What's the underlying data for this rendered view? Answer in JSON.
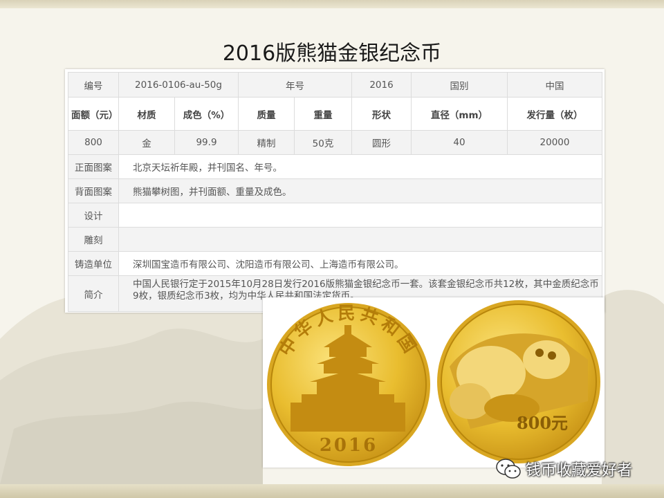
{
  "title": "2016版熊猫金银纪念币",
  "table": {
    "row1": {
      "serial_label": "编号",
      "serial_value": "2016-0106-au-50g",
      "year_label": "年号",
      "year_value": "2016",
      "country_label": "国别",
      "country_value": "中国"
    },
    "headers": [
      "面额（元）",
      "材质",
      "成色（%）",
      "质量",
      "重量",
      "形状",
      "直径（mm）",
      "发行量（枚）"
    ],
    "values": [
      "800",
      "金",
      "99.9",
      "精制",
      "50克",
      "圆形",
      "40",
      "20000"
    ],
    "front": {
      "label": "正面图案",
      "value": "北京天坛祈年殿，并刊国名、年号。"
    },
    "back": {
      "label": "背面图案",
      "value": "熊猫攀树图，并刊面额、重量及成色。"
    },
    "design": {
      "label": "设计",
      "value": ""
    },
    "engrave": {
      "label": "雕刻",
      "value": ""
    },
    "mint": {
      "label": "铸造单位",
      "value": "深圳国宝造币有限公司、沈阳造币有限公司、上海造币有限公司。"
    },
    "intro": {
      "label": "简介",
      "value": "中国人民银行定于2015年10月28日发行2016版熊猫金银纪念币一套。该套金银纪念币共12枚，其中金质纪念币9枚，银质纪念币3枚，均为中华人民共和国法定货币。"
    }
  },
  "coins": {
    "obverse_legend": "中华人民共和国",
    "obverse_year": "2016",
    "reverse_denomination": "800元"
  },
  "watermark": {
    "text": "钱币收藏爱好者",
    "icon": "wechat-icon"
  },
  "colors": {
    "gold": "#e5b62a",
    "gold_dark": "#b8860b",
    "table_border": "#dcdcdc",
    "table_shade": "#f3f3f3"
  }
}
